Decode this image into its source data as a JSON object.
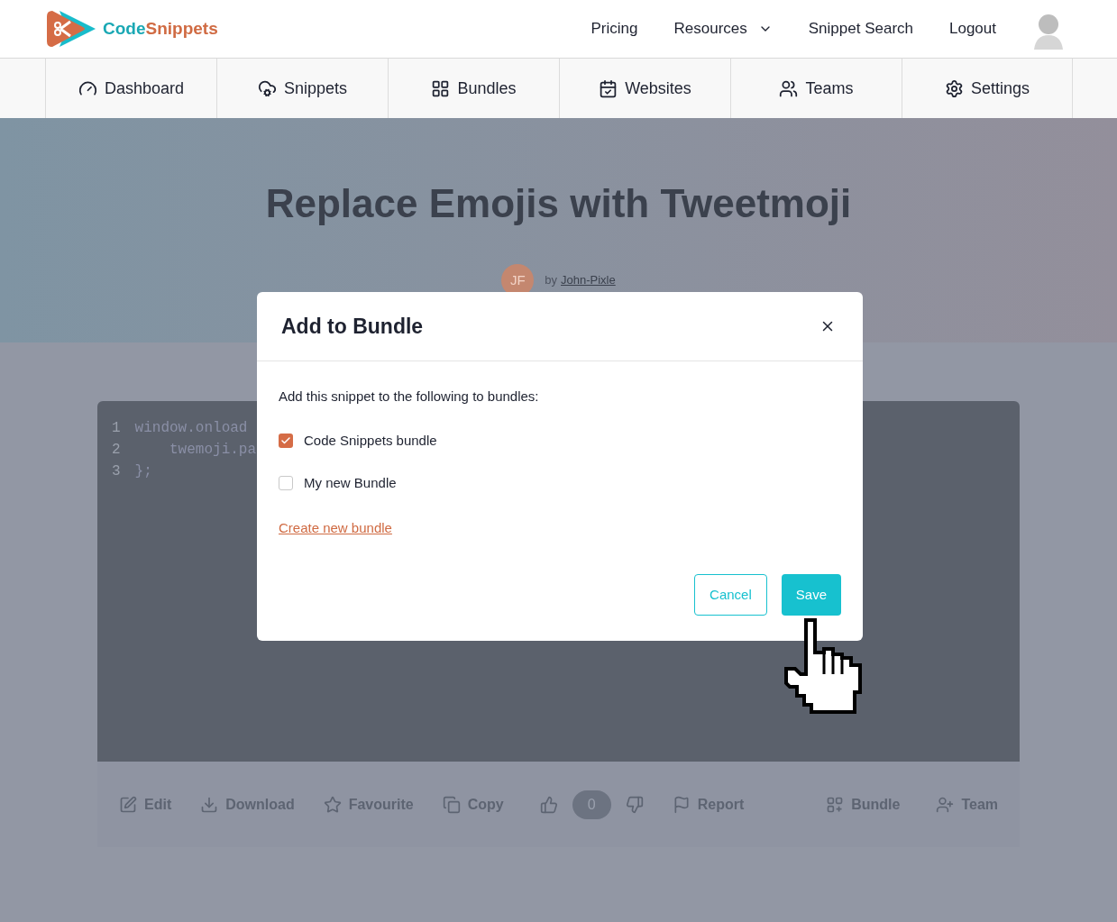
{
  "header": {
    "logo": {
      "first": "Code",
      "second": "Snippets"
    },
    "links": [
      {
        "label": "Pricing",
        "kind": "link"
      },
      {
        "label": "Resources",
        "kind": "dropdown"
      },
      {
        "label": "Snippet Search",
        "kind": "link"
      },
      {
        "label": "Logout",
        "kind": "link"
      }
    ]
  },
  "tabs": [
    {
      "label": "Dashboard"
    },
    {
      "label": "Snippets"
    },
    {
      "label": "Bundles"
    },
    {
      "label": "Websites"
    },
    {
      "label": "Teams"
    },
    {
      "label": "Settings"
    }
  ],
  "hero": {
    "title": "Replace Emojis with Tweetmoji",
    "author": {
      "initials": "JF",
      "prefix": "by",
      "name": "John-Pixle"
    }
  },
  "code": {
    "lines": [
      {
        "number": "1",
        "text": "window.onload"
      },
      {
        "number": "2",
        "text": "    twemoji.pa"
      },
      {
        "number": "3",
        "text": "};"
      }
    ]
  },
  "toolbar": {
    "actions": [
      {
        "label": "Edit"
      },
      {
        "label": "Download"
      },
      {
        "label": "Favourite"
      },
      {
        "label": "Copy"
      }
    ],
    "votes": {
      "count": "0"
    },
    "more_actions": [
      {
        "label": "Report"
      }
    ],
    "right_actions": [
      {
        "label": "Bundle"
      },
      {
        "label": "Team"
      }
    ]
  },
  "modal": {
    "title": "Add to Bundle",
    "prompt": "Add this snippet to the following to bundles:",
    "options": [
      {
        "label": "Code Snippets bundle",
        "checked": true
      },
      {
        "label": "My new Bundle",
        "checked": false
      }
    ],
    "link": "Create new bundle",
    "buttons": [
      {
        "label": "Cancel",
        "kind": "secondary"
      },
      {
        "label": "Save",
        "kind": "primary"
      }
    ]
  }
}
